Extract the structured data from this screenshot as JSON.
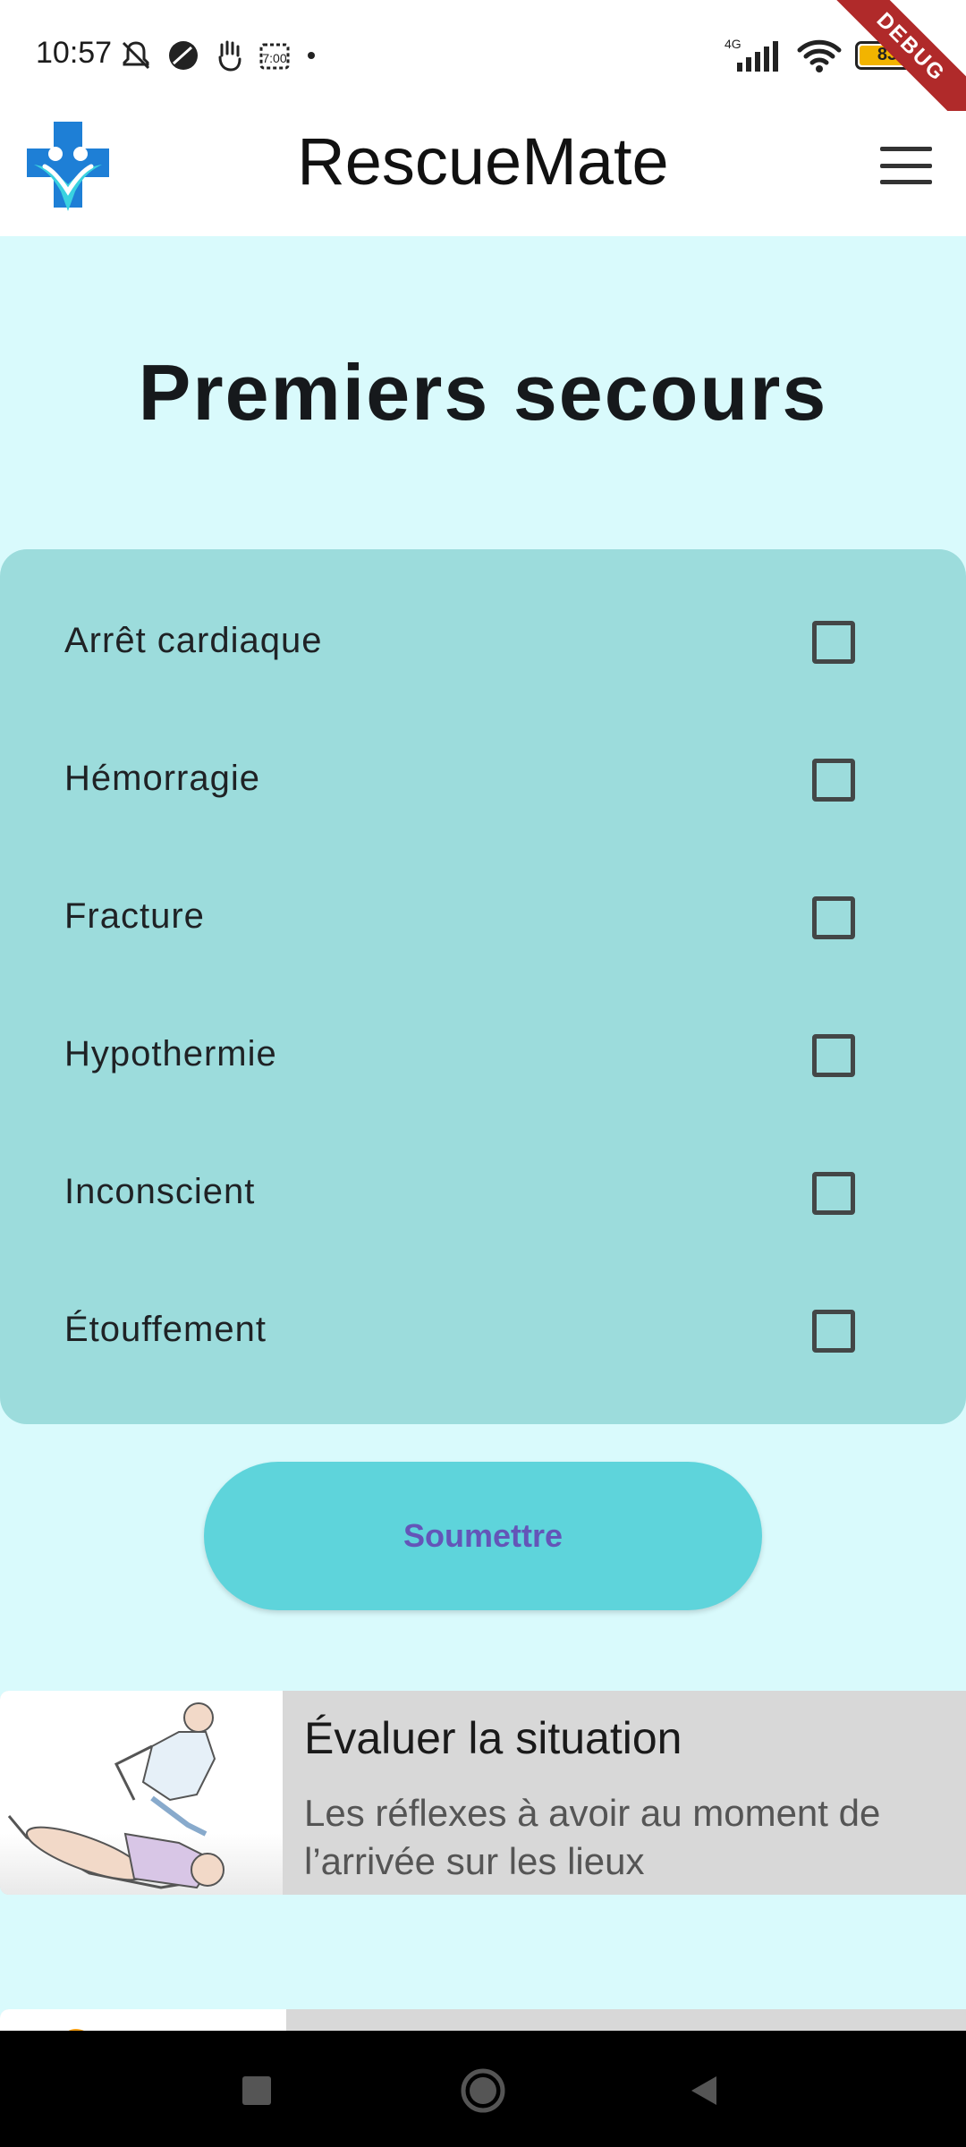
{
  "status_bar": {
    "time": "10:57",
    "battery": "83",
    "network": "4G",
    "debug_badge": "DEBUG"
  },
  "app_bar": {
    "title": "RescueMate",
    "logo_icon": "medical-cross-people-logo",
    "menu_icon": "hamburger-menu-icon"
  },
  "page": {
    "title": "Premiers secours"
  },
  "checklist": {
    "items": [
      {
        "label": "Arrêt cardiaque",
        "checked": false
      },
      {
        "label": "Hémorragie",
        "checked": false
      },
      {
        "label": "Fracture",
        "checked": false
      },
      {
        "label": "Hypothermie",
        "checked": false
      },
      {
        "label": "Inconscient",
        "checked": false
      },
      {
        "label": "Étouffement",
        "checked": false
      }
    ]
  },
  "submit": {
    "label": "Soumettre"
  },
  "info_cards": [
    {
      "title": "Évaluer la situation",
      "description": "Les réflexes à avoir au moment de l’arrivée sur les lieux",
      "image_icon": "first-aid-illustration"
    },
    {
      "title": "",
      "description": "",
      "image_icon": "partial-illustration"
    }
  ],
  "colors": {
    "background": "#d9fafc",
    "card": "#9cdcdc",
    "button": "#5ed4db",
    "button_text": "#6455b8",
    "logo_blue": "#1e7fd6"
  }
}
